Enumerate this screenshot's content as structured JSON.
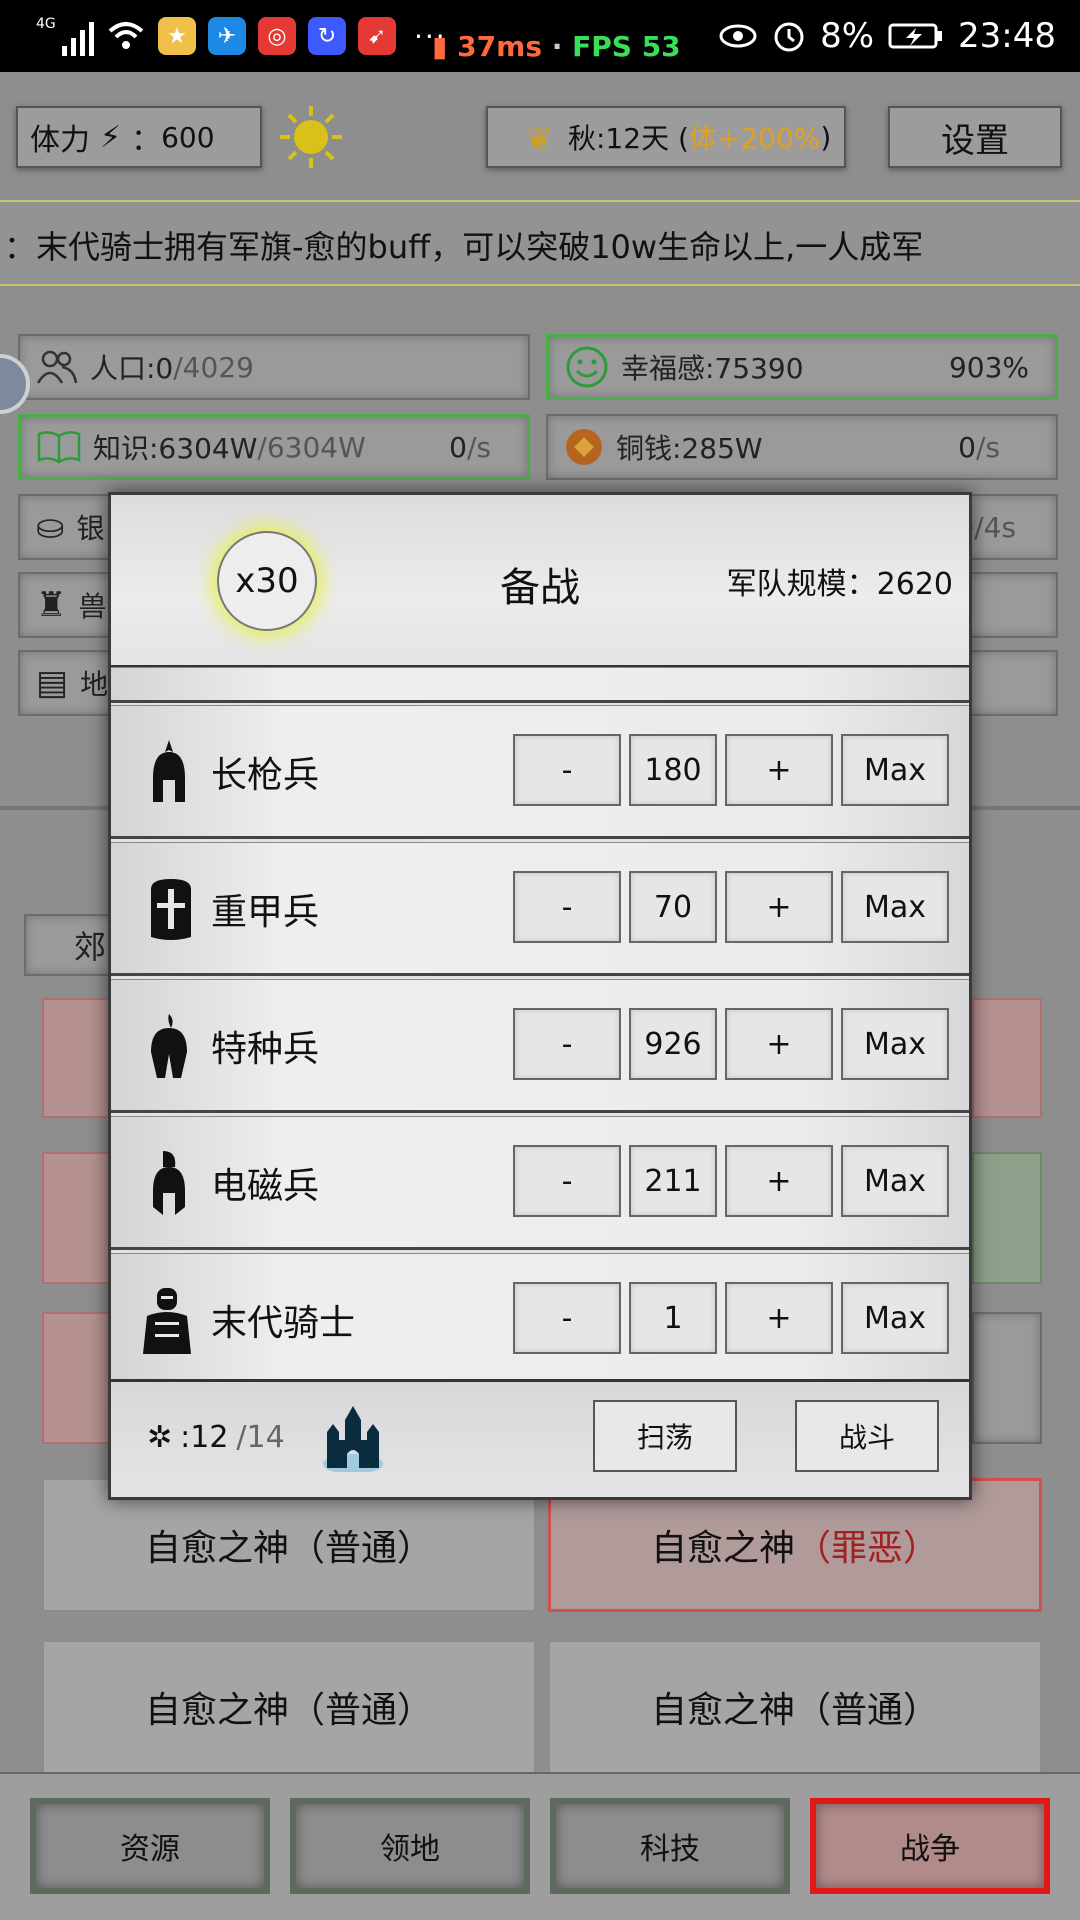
{
  "status_bar": {
    "network": "4G",
    "ping": "37ms",
    "separator": "·",
    "fps": "FPS 53",
    "battery": "8%",
    "time": "23:48",
    "more": "···"
  },
  "top_bar": {
    "stamina_label": "体力",
    "stamina_sep": "：",
    "stamina_value": "600",
    "season_label": "秋:12天 (",
    "season_bonus": "体+200%",
    "season_close": ")",
    "settings_label": "设置"
  },
  "ticker": "：末代骑士拥有军旗-愈的buff，可以突破10w生命以上,一人成军",
  "resources": {
    "population": {
      "label": "人口:0",
      "cap": "/4029"
    },
    "happiness": {
      "label": "幸福感:75390",
      "percent": "903%"
    },
    "knowledge": {
      "label": "知识:6304W",
      "cap": "/6304W",
      "rate": "0",
      "rate_unit": "/s"
    },
    "copper": {
      "label": "铜钱:285W",
      "rate": "0",
      "rate_unit": "/s"
    },
    "silver_partial": "银",
    "silver_rate_partial": "0/4s",
    "beast_partial": "兽",
    "land_partial": "地"
  },
  "region_tab_partial": "郊",
  "battle_cards": [
    {
      "name": "自愈之神",
      "tag": "（普通）"
    },
    {
      "name": "自愈之神",
      "tag": "（罪恶）"
    },
    {
      "name": "自愈之神",
      "tag": "（普通）"
    },
    {
      "name": "自愈之神",
      "tag": "（普通）"
    }
  ],
  "bottom_nav": [
    "资源",
    "领地",
    "科技",
    "战争"
  ],
  "modal": {
    "multiplier": "x30",
    "title": "备战",
    "army_size_label": "军队规模：",
    "army_size_value": "2620",
    "units": [
      {
        "name": "长枪兵",
        "count": "180",
        "icon": "spearman-helmet-icon"
      },
      {
        "name": "重甲兵",
        "count": "70",
        "icon": "heavy-armor-helmet-icon"
      },
      {
        "name": "特种兵",
        "count": "926",
        "icon": "special-forces-helmet-icon"
      },
      {
        "name": "电磁兵",
        "count": "211",
        "icon": "electromagnetic-helmet-icon"
      },
      {
        "name": "末代骑士",
        "count": "1",
        "icon": "knight-icon"
      }
    ],
    "minus_label": "-",
    "plus_label": "+",
    "max_label": "Max",
    "energy_icon": "✲",
    "energy_value": ":12",
    "energy_cap": "/14",
    "sweep_label": "扫荡",
    "fight_label": "战斗"
  },
  "colors": {
    "accent_red": "#e01818",
    "happy_green": "#48b04a",
    "season_bonus": "#e0a020",
    "castle_blue": "#2aa0d8",
    "highlight_yellow": "#e6f046"
  }
}
